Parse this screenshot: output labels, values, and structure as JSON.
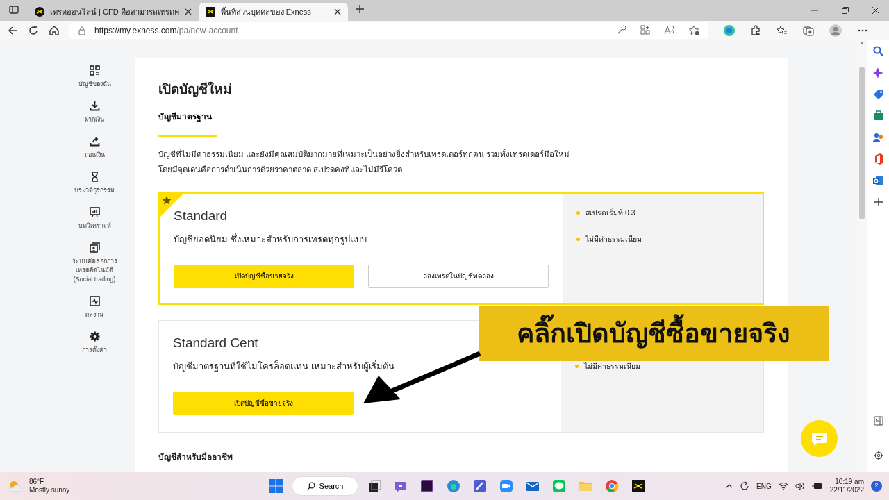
{
  "browser": {
    "tabs": [
      {
        "title": "เทรดออนไลน์ | CFD คือสามารถเทรดค",
        "selected": false
      },
      {
        "title": "พื้นที่ส่วนบุคคลของ Exness",
        "selected": true
      }
    ],
    "url_host": "https://my.exness.com",
    "url_path": "/pa/new-account"
  },
  "nav": [
    {
      "label": "บัญชีของฉัน"
    },
    {
      "label": "ฝากเงิน"
    },
    {
      "label": "ถอนเงิน"
    },
    {
      "label": "ประวัติธุรกรรม"
    },
    {
      "label": "บทวิเคราะห์"
    },
    {
      "label": "ระบบคัดลอกการ\nเทรดอัตโนมัติ\n(Social trading)"
    },
    {
      "label": "ผลงาน"
    },
    {
      "label": "การตั้งค่า"
    }
  ],
  "page": {
    "title": "เปิดบัญชีใหม่",
    "section_tab": "บัญชีมาตรฐาน",
    "description": [
      "บัญชีที่ไม่มีค่าธรรมเนียม และยังมีคุณสมบัติมากมายที่เหมาะเป็นอย่างยิ่งสำหรับเทรดเดอร์ทุกคน รวมทั้งเทรดเดอร์มือใหม่",
      "โดยมีจุดเด่นคือการดำเนินการด้วยราคาตลาด สเปรดคงที่และไม่มีรีโควต"
    ],
    "accounts": [
      {
        "name": "Standard",
        "featured": true,
        "summary": "บัญชียอดนิยม ซึ่งเหมาะสำหรับการเทรดทุกรูปแบบ",
        "buttons": [
          {
            "label": "เปิดบัญชีซื้อขายจริง",
            "kind": "primary"
          },
          {
            "label": "ลองเทรดในบัญชีทดลอง",
            "kind": "outline"
          }
        ],
        "features": [
          "สเปรดเริ่มที่ 0.3",
          "ไม่มีค่าธรรมเนียม"
        ]
      },
      {
        "name": "Standard Cent",
        "featured": false,
        "summary": "บัญชีมาตรฐานที่ใช้ไมโครล็อตแทน เหมาะสำหรับผู้เริ่มต้น",
        "buttons": [
          {
            "label": "เปิดบัญชีซื้อขายจริง",
            "kind": "primary"
          }
        ],
        "features": [
          "ไม่มีค่าธรรมเนียม"
        ]
      }
    ],
    "next_section": "บัญชีสำหรับมืออาชีพ"
  },
  "callout": "คลิ๊กเปิดบัญชีซื้อขายจริง",
  "taskbar": {
    "temperature": "86°F",
    "weather": "Mostly sunny",
    "search": "Search",
    "language": "ENG",
    "time": "10:19 am",
    "date": "22/11/2022",
    "notifications": "2"
  }
}
